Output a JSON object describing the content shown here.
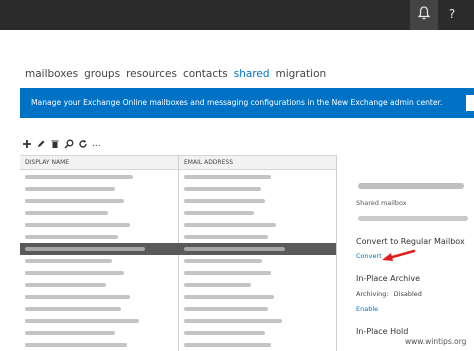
{
  "nav": {
    "items": [
      "mailboxes",
      "groups",
      "resources",
      "contacts",
      "shared",
      "migration"
    ],
    "active_index": 4
  },
  "banner": {
    "text": "Manage your Exchange Online mailboxes and messaging configurations in the New Exchange admin center."
  },
  "toolbar": {
    "more_label": "..."
  },
  "grid": {
    "col_display_name": "DISPLAY NAME",
    "col_email": "EMAIL ADDRESS",
    "rows": [
      {
        "name_w": 0.72,
        "mail_w": 0.62,
        "selected": false
      },
      {
        "name_w": 0.6,
        "mail_w": 0.55,
        "selected": false
      },
      {
        "name_w": 0.66,
        "mail_w": 0.58,
        "selected": false
      },
      {
        "name_w": 0.55,
        "mail_w": 0.5,
        "selected": false
      },
      {
        "name_w": 0.7,
        "mail_w": 0.66,
        "selected": false
      },
      {
        "name_w": 0.62,
        "mail_w": 0.6,
        "selected": false
      },
      {
        "name_w": 0.8,
        "mail_w": 0.72,
        "selected": true
      },
      {
        "name_w": 0.58,
        "mail_w": 0.56,
        "selected": false
      },
      {
        "name_w": 0.66,
        "mail_w": 0.62,
        "selected": false
      },
      {
        "name_w": 0.54,
        "mail_w": 0.48,
        "selected": false
      },
      {
        "name_w": 0.7,
        "mail_w": 0.64,
        "selected": false
      },
      {
        "name_w": 0.64,
        "mail_w": 0.6,
        "selected": false
      },
      {
        "name_w": 0.76,
        "mail_w": 0.7,
        "selected": false
      },
      {
        "name_w": 0.6,
        "mail_w": 0.58,
        "selected": false
      },
      {
        "name_w": 0.68,
        "mail_w": 0.62,
        "selected": false
      }
    ]
  },
  "details": {
    "type_label": "Shared mailbox",
    "convert_heading": "Convert to Regular Mailbox",
    "convert_link": "Convert",
    "archive_heading": "In-Place Archive",
    "archiving_label": "Archiving:",
    "archiving_value": "Disabled",
    "enable_link": "Enable",
    "hold_heading": "In-Place Hold"
  },
  "watermark": "www.wintips.org",
  "icons": {
    "topbar": [
      "bell-icon",
      "help-icon"
    ],
    "toolbar": [
      "add-icon",
      "edit-icon",
      "delete-icon",
      "search-icon",
      "refresh-icon"
    ]
  },
  "colors": {
    "accent": "#0072c6",
    "topbar": "#2b2b2b",
    "selected_row": "#5a5a5a",
    "arrow": "#e02020"
  }
}
